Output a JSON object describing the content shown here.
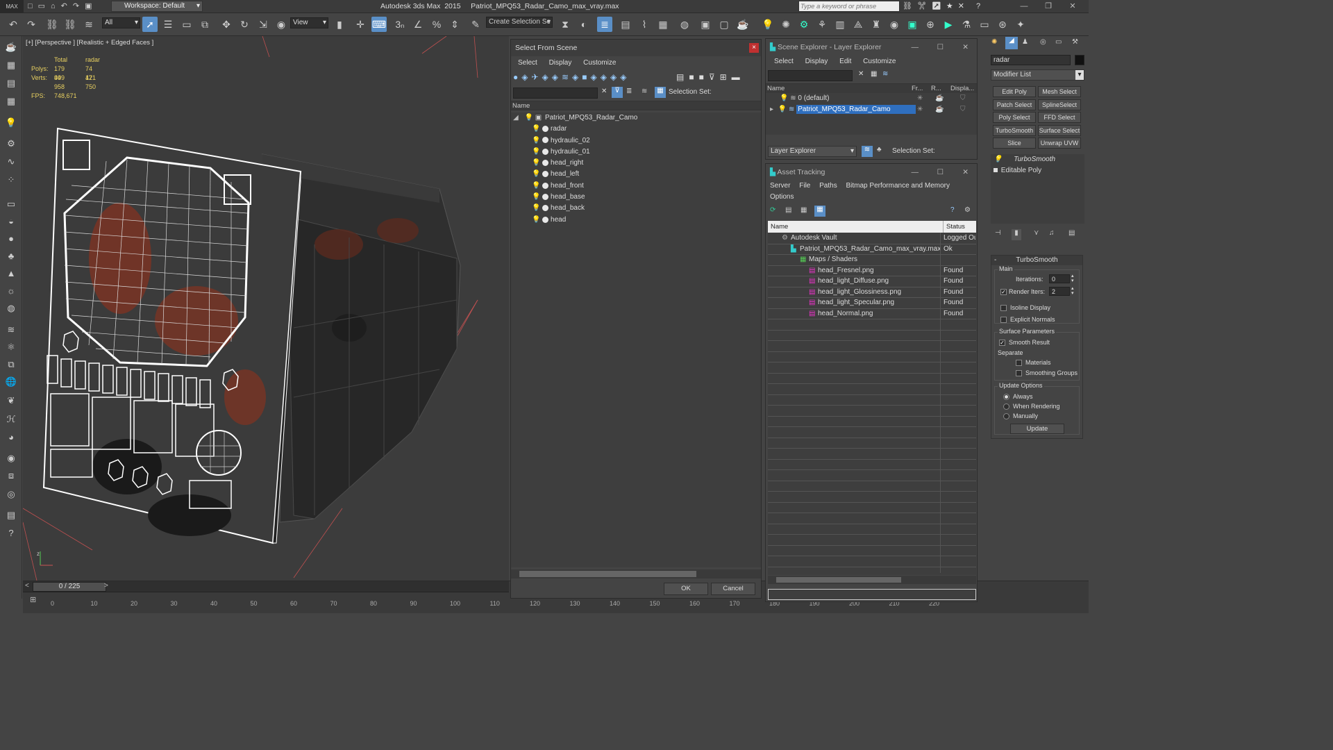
{
  "app": {
    "title": "Autodesk 3ds Max  2015     Patriot_MPQ53_Radar_Camo_max_vray.max",
    "workspace": "Workspace: Default",
    "search_placeholder": "Type a keyword or phrase",
    "filter_select": "All",
    "view_select": "View",
    "create_selection_set": "Create Selection Se"
  },
  "viewport": {
    "label": "[+] [Perspective ] [Realistic + Edged Faces ]",
    "stats": {
      "col_total": "Total",
      "col_radar": "radar",
      "polys_label": "Polys:",
      "polys_total": "179 449",
      "polys_radar": "74 171",
      "verts_label": "Verts:",
      "verts_total": "99 958",
      "verts_radar": "42 750",
      "fps_label": "FPS:",
      "fps_value": "748,671"
    }
  },
  "timeline": {
    "frame": "0 / 225",
    "ticks": [
      "0",
      "10",
      "20",
      "30",
      "40",
      "50",
      "60",
      "70",
      "80",
      "90",
      "100",
      "110",
      "120",
      "130",
      "140",
      "150",
      "160",
      "170",
      "180",
      "190",
      "200",
      "210",
      "220"
    ]
  },
  "select_from_scene": {
    "title": "Select From Scene",
    "menus": [
      "Select",
      "Display",
      "Customize"
    ],
    "selection_set_label": "Selection Set:",
    "column_name": "Name",
    "root": "Patriot_MPQ53_Radar_Camo",
    "items": [
      "radar",
      "hydraulic_02",
      "hydraulic_01",
      "head_right",
      "head_left",
      "head_front",
      "head_base",
      "head_back",
      "head"
    ],
    "ok": "OK",
    "cancel": "Cancel"
  },
  "scene_explorer": {
    "title": "Scene Explorer - Layer Explorer",
    "menus": [
      "Select",
      "Display",
      "Edit",
      "Customize"
    ],
    "columns": [
      "Name",
      "Fr...",
      "R...",
      "Displa..."
    ],
    "layers": [
      "0 (default)",
      "Patriot_MPQ53_Radar_Camo"
    ],
    "footer_select": "Layer Explorer",
    "selection_set_label": "Selection Set:"
  },
  "asset_tracking": {
    "title": "Asset Tracking",
    "menus": [
      "Server",
      "File",
      "Paths",
      "Bitmap Performance and Memory"
    ],
    "menu2": "Options",
    "col_name": "Name",
    "col_status": "Status",
    "rows": [
      {
        "name": "Autodesk Vault",
        "status": "Logged Ou",
        "indent": 0
      },
      {
        "name": "Patriot_MPQ53_Radar_Camo_max_vray.max",
        "status": "Ok",
        "indent": 1
      },
      {
        "name": "Maps / Shaders",
        "status": "",
        "indent": 2
      },
      {
        "name": "head_Fresnel.png",
        "status": "Found",
        "indent": 3
      },
      {
        "name": "head_light_Diffuse.png",
        "status": "Found",
        "indent": 3
      },
      {
        "name": "head_light_Glossiness.png",
        "status": "Found",
        "indent": 3
      },
      {
        "name": "head_light_Specular.png",
        "status": "Found",
        "indent": 3
      },
      {
        "name": "head_Normal.png",
        "status": "Found",
        "indent": 3
      }
    ]
  },
  "command_panel": {
    "object_name": "radar",
    "modifier_list": "Modifier List",
    "buttons": [
      "Edit Poly",
      "Mesh Select",
      "Patch Select",
      "SplineSelect",
      "Poly Select",
      "FFD Select",
      "TurboSmooth",
      "Surface Select",
      "Slice",
      "Unwrap UVW"
    ],
    "stack": [
      "TurboSmooth",
      "Editable Poly"
    ],
    "rollout_title": "TurboSmooth",
    "main_label": "Main",
    "iterations_label": "Iterations:",
    "iterations_value": "0",
    "render_iters_label": "Render Iters:",
    "render_iters_value": "2",
    "isoline_label": "Isoline Display",
    "explicit_normals_label": "Explicit Normals",
    "surface_params_label": "Surface Parameters",
    "smooth_result_label": "Smooth Result",
    "separate_label": "Separate",
    "materials_label": "Materials",
    "smoothing_groups_label": "Smoothing Groups",
    "update_options_label": "Update Options",
    "always_label": "Always",
    "when_rendering_label": "When Rendering",
    "manually_label": "Manually",
    "update_button": "Update"
  },
  "colors": {
    "accent": "#5a8fc7",
    "selection": "#2f6fbf",
    "bulb": "#f0d040",
    "camo_red": "#8a3a2a",
    "wire": "#ffffff"
  }
}
